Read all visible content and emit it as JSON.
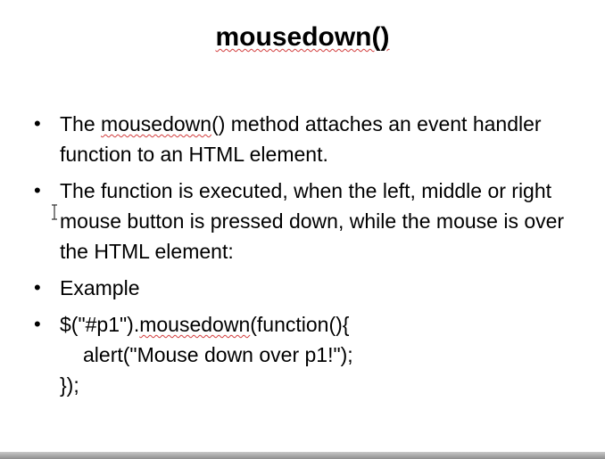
{
  "slide": {
    "title": "mousedown()",
    "bullets": [
      {
        "before": "The ",
        "keyword": "mousedown",
        "after": "() method attaches an event handler function to an HTML element."
      },
      {
        "text": "The function is executed, when the left, middle or right mouse button is pressed down, while the mouse is over the HTML element:"
      },
      {
        "text": "Example"
      },
      {
        "code_line1_before": "$(\"#p1\").",
        "code_line1_keyword": "mousedown",
        "code_line1_after": "(function(){",
        "code_line2": "alert(\"Mouse down over p1!\");",
        "code_line3": "});"
      }
    ]
  },
  "icons": {
    "cursor": "text-cursor-icon",
    "bullet": "bullet-dot"
  },
  "colors": {
    "spellcheck_underline": "#d23c3c",
    "text": "#000000",
    "background": "#ffffff"
  }
}
